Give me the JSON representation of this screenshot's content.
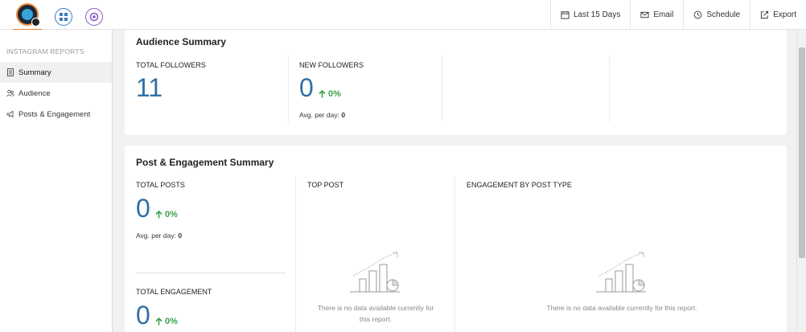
{
  "topbar": {
    "apps": [
      {
        "icon": "brand-logo-icon"
      },
      {
        "icon": "grid-app-icon",
        "color": "#3b78c4"
      },
      {
        "icon": "circle-app-icon",
        "color": "#8a56c9"
      }
    ],
    "actions": [
      {
        "label": "Last 15 Days",
        "icon": "calendar-icon"
      },
      {
        "label": "Email",
        "icon": "mail-icon"
      },
      {
        "label": "Schedule",
        "icon": "clock-icon"
      },
      {
        "label": "Export",
        "icon": "export-icon"
      }
    ]
  },
  "sidebar": {
    "header": "INSTAGRAM REPORTS",
    "items": [
      {
        "label": "Summary",
        "icon": "document-icon",
        "active": true
      },
      {
        "label": "Audience",
        "icon": "people-icon",
        "active": false
      },
      {
        "label": "Posts & Engagement",
        "icon": "megaphone-icon",
        "active": false
      }
    ]
  },
  "audience_summary": {
    "title": "Audience Summary",
    "total_followers": {
      "label": "TOTAL FOLLOWERS",
      "value": "11"
    },
    "new_followers": {
      "label": "NEW FOLLOWERS",
      "value": "0",
      "delta": "0%",
      "avg_label": "Avg. per day:",
      "avg_value": "0"
    }
  },
  "post_engagement_summary": {
    "title": "Post & Engagement Summary",
    "total_posts": {
      "label": "TOTAL POSTS",
      "value": "0",
      "delta": "0%",
      "avg_label": "Avg. per day:",
      "avg_value": "0"
    },
    "total_engagement": {
      "label": "TOTAL ENGAGEMENT",
      "value": "0",
      "delta": "0%"
    },
    "top_post": {
      "label": "TOP POST",
      "empty_line1": "There is no data available currently for",
      "empty_line2": "this report."
    },
    "engagement_by_type": {
      "label": "ENGAGEMENT BY POST TYPE",
      "empty_text": "There is no data available currently for this report."
    }
  },
  "colors": {
    "accent_number": "#2f6fa6",
    "positive": "#3aa34a",
    "brand_orange": "#e97c2e"
  }
}
